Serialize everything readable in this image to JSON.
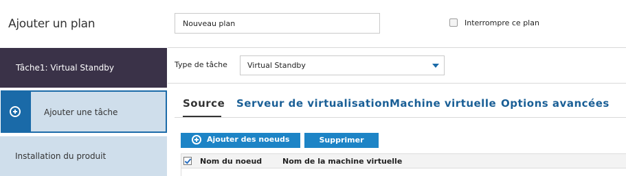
{
  "sidebar": {
    "title": "Ajouter un plan",
    "items": [
      {
        "label": "Tâche1: Virtual Standby"
      },
      {
        "label": "Ajouter une tâche"
      },
      {
        "label": "Installation du produit"
      }
    ]
  },
  "plan": {
    "name_value": "Nouveau plan",
    "interrupt_label": "Interrompre ce plan",
    "interrupt_checked": false
  },
  "task": {
    "type_label": "Type de tâche",
    "type_value": "Virtual Standby"
  },
  "tabs": [
    {
      "label": "Source",
      "active": true
    },
    {
      "label": "Serveur de virtualisation",
      "active": false
    },
    {
      "label": "Machine virtuelle",
      "active": false
    },
    {
      "label": "Options avancées",
      "active": false
    }
  ],
  "toolbar": {
    "add_nodes_label": "Ajouter des noeuds",
    "delete_label": "Supprimer"
  },
  "table": {
    "columns": [
      "Nom du noeud",
      "Nom de la machine virtuelle"
    ],
    "select_all_checked": true
  },
  "colors": {
    "accent": "#1d84c6",
    "sidebar_active": "#3a3248",
    "sidebar_light": "#cfdeeb",
    "tab_text": "#1a5f96"
  },
  "icons": [
    "plus-circle-icon",
    "chevron-down-icon",
    "checkbox-icon"
  ]
}
